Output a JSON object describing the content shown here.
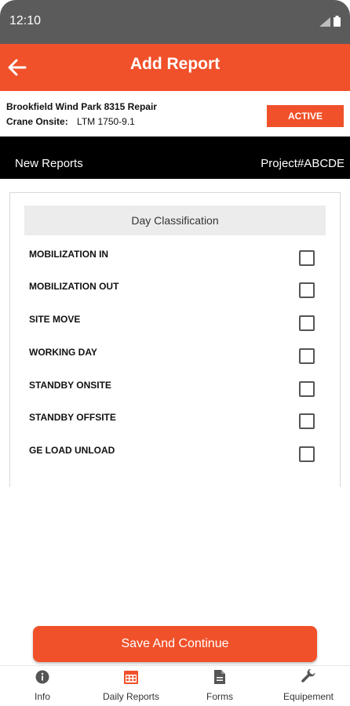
{
  "status_bar": {
    "time": "12:10"
  },
  "app_bar": {
    "title": "Add Report"
  },
  "project": {
    "name": "Brookfield Wind Park 8315 Repair",
    "crane_label": "Crane Onsite:",
    "crane_value": "LTM 1750-9.1",
    "status": "ACTIVE"
  },
  "subheader": {
    "left": "New Reports",
    "right": "Project#ABCDE"
  },
  "classification": {
    "title": "Day Classification",
    "items": [
      {
        "label": "MOBILIZATION IN",
        "checked": false
      },
      {
        "label": "MOBILIZATION OUT",
        "checked": false
      },
      {
        "label": "SITE MOVE",
        "checked": false
      },
      {
        "label": "WORKING DAY",
        "checked": false
      },
      {
        "label": "STANDBY ONSITE",
        "checked": false
      },
      {
        "label": "STANDBY OFFSITE",
        "checked": false
      },
      {
        "label": "GE LOAD UNLOAD",
        "checked": false
      }
    ]
  },
  "save_button": {
    "label": "Save And Continue"
  },
  "bottom_nav": {
    "items": [
      {
        "label": "Info",
        "icon": "info-icon"
      },
      {
        "label": "Daily Reports",
        "icon": "calendar-icon"
      },
      {
        "label": "Forms",
        "icon": "document-icon"
      },
      {
        "label": "Equipement",
        "icon": "wrench-icon"
      }
    ],
    "active_index": 1
  },
  "colors": {
    "accent": "#f0512a",
    "subheader_bg": "#000000",
    "status_bar_bg": "#5b5b5b"
  }
}
